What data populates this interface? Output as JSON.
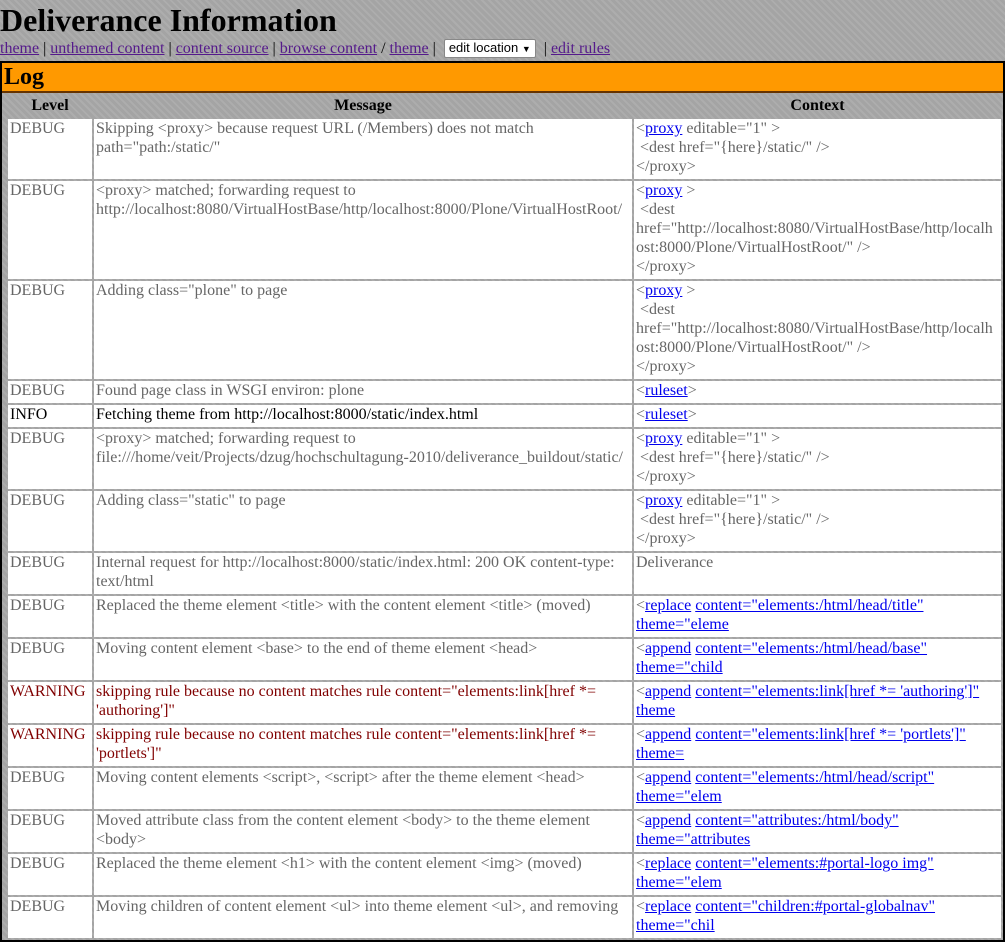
{
  "title": "Deliverance Information",
  "nav": {
    "theme": "theme",
    "unthemed": "unthemed content",
    "source": "content source",
    "browse": "browse content",
    "slash": "/",
    "theme2": "theme",
    "select": "edit location",
    "rules": "edit rules"
  },
  "log": {
    "title": "Log",
    "headers": {
      "level": "Level",
      "message": "Message",
      "context": "Context"
    },
    "rows": [
      {
        "level": "DEBUG",
        "message": "Skipping <proxy> because request URL (/Members) does not match path=\"path:/static/\"",
        "context": [
          [
            [
              "<",
              0
            ],
            [
              "proxy",
              1
            ],
            [
              " editable=\"1\" >",
              0
            ]
          ],
          [
            [
              " <dest href=\"{here}/static/\" />",
              0
            ]
          ],
          [
            [
              "</proxy>",
              0
            ]
          ]
        ]
      },
      {
        "level": "DEBUG",
        "message": "<proxy> matched; forwarding request to http://localhost:8080/VirtualHostBase/http/localhost:8000/Plone/VirtualHostRoot/",
        "context": [
          [
            [
              "<",
              0
            ],
            [
              "proxy",
              1
            ],
            [
              " >",
              0
            ]
          ],
          [
            [
              " <dest href=\"http://localhost:8080/VirtualHostBase/http/localhost:8000/Plone/VirtualHostRoot/\" />",
              0
            ]
          ],
          [
            [
              "</proxy>",
              0
            ]
          ]
        ]
      },
      {
        "level": "DEBUG",
        "message": "Adding class=\"plone\" to page",
        "context": [
          [
            [
              "<",
              0
            ],
            [
              "proxy",
              1
            ],
            [
              " >",
              0
            ]
          ],
          [
            [
              " <dest href=\"http://localhost:8080/VirtualHostBase/http/localhost:8000/Plone/VirtualHostRoot/\" />",
              0
            ]
          ],
          [
            [
              "</proxy>",
              0
            ]
          ]
        ]
      },
      {
        "level": "DEBUG",
        "message": "Found page class in WSGI environ: plone",
        "context": [
          [
            [
              "<",
              0
            ],
            [
              "ruleset",
              1
            ],
            [
              ">",
              0
            ]
          ]
        ]
      },
      {
        "level": "INFO",
        "message": "Fetching theme from http://localhost:8000/static/index.html",
        "context": [
          [
            [
              "<",
              0
            ],
            [
              "ruleset",
              1
            ],
            [
              ">",
              0
            ]
          ]
        ]
      },
      {
        "level": "DEBUG",
        "message": "<proxy> matched; forwarding request to file:///home/veit/Projects/dzug/hochschultagung-2010/deliverance_buildout/static/",
        "context": [
          [
            [
              "<",
              0
            ],
            [
              "proxy",
              1
            ],
            [
              " editable=\"1\" >",
              0
            ]
          ],
          [
            [
              " <dest href=\"{here}/static/\" />",
              0
            ]
          ],
          [
            [
              "</proxy>",
              0
            ]
          ]
        ]
      },
      {
        "level": "DEBUG",
        "message": "Adding class=\"static\" to page",
        "context": [
          [
            [
              "<",
              0
            ],
            [
              "proxy",
              1
            ],
            [
              " editable=\"1\" >",
              0
            ]
          ],
          [
            [
              " <dest href=\"{here}/static/\" />",
              0
            ]
          ],
          [
            [
              "</proxy>",
              0
            ]
          ]
        ]
      },
      {
        "level": "DEBUG",
        "message": "Internal request for http://localhost:8000/static/index.html: 200 OK content-type: text/html",
        "context": [
          [
            [
              "Deliverance",
              0
            ]
          ]
        ]
      },
      {
        "level": "DEBUG",
        "message": "Replaced the theme element <title> with the content element <title> (moved)",
        "context": [
          [
            [
              "<",
              0
            ],
            [
              "replace",
              1
            ],
            [
              " ",
              0
            ],
            [
              "content=\"elements:/html/head/title\"",
              1
            ],
            [
              " ",
              0
            ],
            [
              "theme=\"eleme",
              1
            ]
          ]
        ]
      },
      {
        "level": "DEBUG",
        "message": "Moving content element <base> to the end of theme element <head>",
        "context": [
          [
            [
              "<",
              0
            ],
            [
              "append",
              1
            ],
            [
              " ",
              0
            ],
            [
              "content=\"elements:/html/head/base\"",
              1
            ],
            [
              " ",
              0
            ],
            [
              "theme=\"child",
              1
            ]
          ]
        ]
      },
      {
        "level": "WARNING",
        "message": "skipping rule because no content matches rule content=\"elements:link[href *= 'authoring']\"",
        "context": [
          [
            [
              "<",
              0
            ],
            [
              "append",
              1
            ],
            [
              " ",
              0
            ],
            [
              "content=\"elements:link[href *= 'authoring']\"",
              1
            ],
            [
              " ",
              0
            ],
            [
              "theme",
              1
            ]
          ]
        ]
      },
      {
        "level": "WARNING",
        "message": "skipping rule because no content matches rule content=\"elements:link[href *= 'portlets']\"",
        "context": [
          [
            [
              "<",
              0
            ],
            [
              "append",
              1
            ],
            [
              " ",
              0
            ],
            [
              "content=\"elements:link[href *= 'portlets']\"",
              1
            ],
            [
              " ",
              0
            ],
            [
              "theme=",
              1
            ]
          ]
        ]
      },
      {
        "level": "DEBUG",
        "message": "Moving content elements <script>, <script> after the theme element <head>",
        "context": [
          [
            [
              "<",
              0
            ],
            [
              "append",
              1
            ],
            [
              " ",
              0
            ],
            [
              "content=\"elements:/html/head/script\"",
              1
            ],
            [
              " ",
              0
            ],
            [
              "theme=\"elem",
              1
            ]
          ]
        ]
      },
      {
        "level": "DEBUG",
        "message": "Moved attribute class from the content element <body> to the theme element <body>",
        "context": [
          [
            [
              "<",
              0
            ],
            [
              "append",
              1
            ],
            [
              " ",
              0
            ],
            [
              "content=\"attributes:/html/body\"",
              1
            ],
            [
              " ",
              0
            ],
            [
              "theme=\"attributes",
              1
            ]
          ]
        ]
      },
      {
        "level": "DEBUG",
        "message": "Replaced the theme element <h1> with the content element <img> (moved)",
        "context": [
          [
            [
              "<",
              0
            ],
            [
              "replace",
              1
            ],
            [
              " ",
              0
            ],
            [
              "content=\"elements:#portal-logo img\"",
              1
            ],
            [
              " ",
              0
            ],
            [
              "theme=\"elem",
              1
            ]
          ]
        ]
      },
      {
        "level": "DEBUG",
        "message": "Moving children of content element <ul> into theme element <ul>, and removing",
        "context": [
          [
            [
              "<",
              0
            ],
            [
              "replace",
              1
            ],
            [
              " ",
              0
            ],
            [
              "content=\"children:#portal-globalnav\"",
              1
            ],
            [
              " ",
              0
            ],
            [
              "theme=\"chil",
              1
            ]
          ]
        ]
      }
    ]
  },
  "colors": {
    "header": "#ff9900",
    "DEBUG": "#666666",
    "INFO": "#000000",
    "WARNING": "#800000",
    "link": "#0000ee"
  }
}
